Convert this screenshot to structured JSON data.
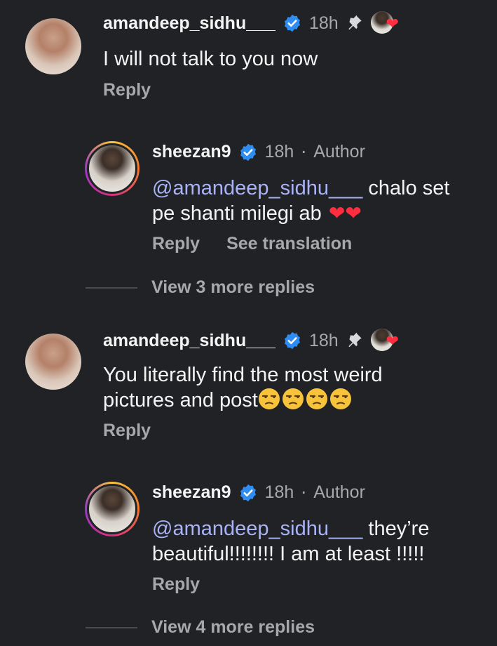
{
  "comments": [
    {
      "username": "amandeep_sidhu___",
      "time": "18h",
      "text": "I will not talk to you now",
      "reply_label": "Reply"
    },
    {
      "username": "sheezan9",
      "time": "18h",
      "author_label": "Author",
      "separator": "·",
      "mention": "@amandeep_sidhu___",
      "text_line1": " chalo set",
      "text_line2": "pe shanti milegi ab ",
      "hearts": "❤❤",
      "reply_label": "Reply",
      "translate_label": "See translation",
      "more_replies": "View 3 more replies"
    },
    {
      "username": "amandeep_sidhu___",
      "time": "18h",
      "text_line1": "You literally find the most weird",
      "text_line2": "pictures and post",
      "reply_label": "Reply"
    },
    {
      "username": "sheezan9",
      "time": "18h",
      "author_label": "Author",
      "separator": "·",
      "mention": "@amandeep_sidhu___",
      "text_line1": " they’re",
      "text_line2": "beautiful!!!!!!!! I am at least !!!!!",
      "reply_label": "Reply",
      "more_replies": "View 4 more replies"
    }
  ],
  "colors": {
    "background": "#212226",
    "verified": "#2f8cf0",
    "mention": "#a9b3f5",
    "heart": "#ff2d3f",
    "muted": "#a8a8ab"
  }
}
